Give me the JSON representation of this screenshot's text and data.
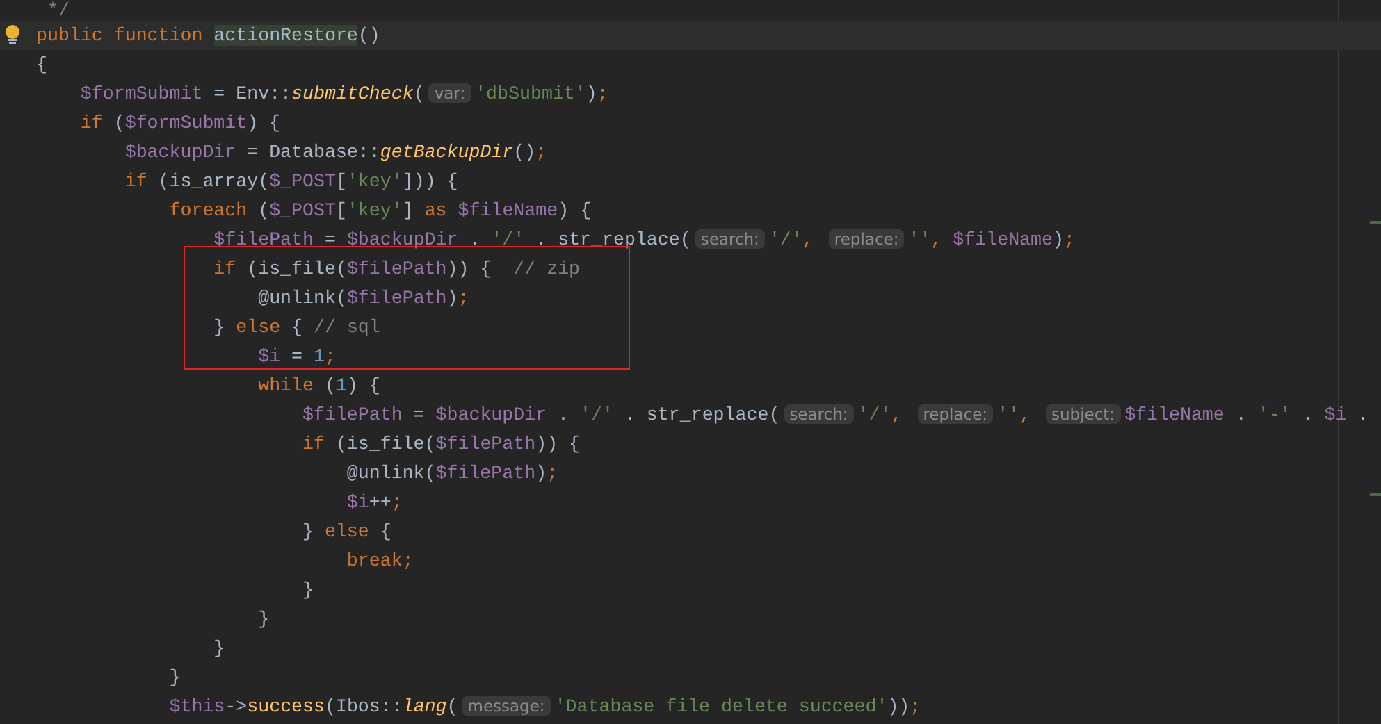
{
  "editor": {
    "lines": [
      {
        "current": false,
        "boxed": false,
        "tokens": [
          {
            "kind": "comment",
            "text": " */"
          }
        ]
      },
      {
        "current": true,
        "boxed": false,
        "tokens": [
          {
            "kind": "keyword",
            "text": "public function "
          },
          {
            "kind": "declaration",
            "text": "actionRestore"
          },
          {
            "kind": "plain",
            "text": "()"
          }
        ]
      },
      {
        "current": false,
        "boxed": false,
        "tokens": [
          {
            "kind": "plain",
            "text": "{"
          }
        ]
      },
      {
        "current": false,
        "boxed": false,
        "tokens": [
          {
            "kind": "variable",
            "text": "    $formSubmit"
          },
          {
            "kind": "plain",
            "text": " = Env::"
          },
          {
            "kind": "static",
            "text": "submitCheck"
          },
          {
            "kind": "plain",
            "text": "("
          },
          {
            "kind": "hint",
            "text": "var:"
          },
          {
            "kind": "string",
            "text": "'dbSubmit'"
          },
          {
            "kind": "plain",
            "text": ")"
          },
          {
            "kind": "keyword",
            "text": ";"
          }
        ]
      },
      {
        "current": false,
        "boxed": false,
        "tokens": [
          {
            "kind": "keyword",
            "text": "    if "
          },
          {
            "kind": "plain",
            "text": "("
          },
          {
            "kind": "variable",
            "text": "$formSubmit"
          },
          {
            "kind": "plain",
            "text": ") {"
          }
        ]
      },
      {
        "current": false,
        "boxed": false,
        "tokens": [
          {
            "kind": "variable",
            "text": "        $backupDir"
          },
          {
            "kind": "plain",
            "text": " = Database::"
          },
          {
            "kind": "static",
            "text": "getBackupDir"
          },
          {
            "kind": "plain",
            "text": "()"
          },
          {
            "kind": "keyword",
            "text": ";"
          }
        ]
      },
      {
        "current": false,
        "boxed": false,
        "tokens": [
          {
            "kind": "keyword",
            "text": "        if "
          },
          {
            "kind": "plain",
            "text": "(is_array("
          },
          {
            "kind": "variable",
            "text": "$_POST"
          },
          {
            "kind": "plain",
            "text": "["
          },
          {
            "kind": "string",
            "text": "'key'"
          },
          {
            "kind": "plain",
            "text": "])) {"
          }
        ]
      },
      {
        "current": false,
        "boxed": false,
        "tokens": [
          {
            "kind": "keyword",
            "text": "            foreach "
          },
          {
            "kind": "plain",
            "text": "("
          },
          {
            "kind": "variable",
            "text": "$_POST"
          },
          {
            "kind": "plain",
            "text": "["
          },
          {
            "kind": "string",
            "text": "'key'"
          },
          {
            "kind": "plain",
            "text": "] "
          },
          {
            "kind": "keyword",
            "text": "as "
          },
          {
            "kind": "variable",
            "text": "$fileName"
          },
          {
            "kind": "plain",
            "text": ") {"
          }
        ]
      },
      {
        "current": false,
        "boxed": false,
        "tokens": [
          {
            "kind": "variable",
            "text": "                $filePath"
          },
          {
            "kind": "plain",
            "text": " = "
          },
          {
            "kind": "variable",
            "text": "$backupDir"
          },
          {
            "kind": "plain",
            "text": " . "
          },
          {
            "kind": "string",
            "text": "'/'"
          },
          {
            "kind": "plain",
            "text": " . str_replace("
          },
          {
            "kind": "hint",
            "text": "search:"
          },
          {
            "kind": "string",
            "text": "'/'"
          },
          {
            "kind": "keyword",
            "text": ", "
          },
          {
            "kind": "hint",
            "text": "replace:"
          },
          {
            "kind": "string",
            "text": "''"
          },
          {
            "kind": "keyword",
            "text": ", "
          },
          {
            "kind": "variable",
            "text": "$fileName"
          },
          {
            "kind": "plain",
            "text": ")"
          },
          {
            "kind": "keyword",
            "text": ";"
          }
        ]
      },
      {
        "current": false,
        "boxed": true,
        "tokens": [
          {
            "kind": "keyword",
            "text": "                if "
          },
          {
            "kind": "plain",
            "text": "(is_file("
          },
          {
            "kind": "variable",
            "text": "$filePath"
          },
          {
            "kind": "plain",
            "text": ")) {  "
          },
          {
            "kind": "comment",
            "text": "// zip"
          }
        ]
      },
      {
        "current": false,
        "boxed": true,
        "tokens": [
          {
            "kind": "plain",
            "text": "                    @unlink("
          },
          {
            "kind": "variable",
            "text": "$filePath"
          },
          {
            "kind": "plain",
            "text": ")"
          },
          {
            "kind": "keyword",
            "text": ";"
          }
        ]
      },
      {
        "current": false,
        "boxed": true,
        "tokens": [
          {
            "kind": "plain",
            "text": "                } "
          },
          {
            "kind": "keyword",
            "text": "else "
          },
          {
            "kind": "plain",
            "text": "{ "
          },
          {
            "kind": "comment",
            "text": "// sql"
          }
        ]
      },
      {
        "current": false,
        "boxed": true,
        "tokens": [
          {
            "kind": "variable",
            "text": "                    $i"
          },
          {
            "kind": "plain",
            "text": " = "
          },
          {
            "kind": "number",
            "text": "1"
          },
          {
            "kind": "keyword",
            "text": ";"
          }
        ]
      },
      {
        "current": false,
        "boxed": false,
        "tokens": [
          {
            "kind": "keyword",
            "text": "                    while "
          },
          {
            "kind": "plain",
            "text": "("
          },
          {
            "kind": "number",
            "text": "1"
          },
          {
            "kind": "plain",
            "text": ") {"
          }
        ]
      },
      {
        "current": false,
        "boxed": false,
        "tokens": [
          {
            "kind": "variable",
            "text": "                        $filePath"
          },
          {
            "kind": "plain",
            "text": " = "
          },
          {
            "kind": "variable",
            "text": "$backupDir"
          },
          {
            "kind": "plain",
            "text": " . "
          },
          {
            "kind": "string",
            "text": "'/'"
          },
          {
            "kind": "plain",
            "text": " . str_replace("
          },
          {
            "kind": "hint",
            "text": "search:"
          },
          {
            "kind": "string",
            "text": "'/'"
          },
          {
            "kind": "keyword",
            "text": ", "
          },
          {
            "kind": "hint",
            "text": "replace:"
          },
          {
            "kind": "string",
            "text": "''"
          },
          {
            "kind": "keyword",
            "text": ", "
          },
          {
            "kind": "hint",
            "text": "subject:"
          },
          {
            "kind": "variable",
            "text": "$fileName"
          },
          {
            "kind": "plain",
            "text": " . "
          },
          {
            "kind": "string",
            "text": "'-'"
          },
          {
            "kind": "plain",
            "text": " . "
          },
          {
            "kind": "variable",
            "text": "$i"
          },
          {
            "kind": "plain",
            "text": " ."
          }
        ]
      },
      {
        "current": false,
        "boxed": false,
        "tokens": [
          {
            "kind": "keyword",
            "text": "                        if "
          },
          {
            "kind": "plain",
            "text": "(is_file("
          },
          {
            "kind": "variable",
            "text": "$filePath"
          },
          {
            "kind": "plain",
            "text": ")) {"
          }
        ]
      },
      {
        "current": false,
        "boxed": false,
        "tokens": [
          {
            "kind": "plain",
            "text": "                            @unlink("
          },
          {
            "kind": "variable",
            "text": "$filePath"
          },
          {
            "kind": "plain",
            "text": ")"
          },
          {
            "kind": "keyword",
            "text": ";"
          }
        ]
      },
      {
        "current": false,
        "boxed": false,
        "tokens": [
          {
            "kind": "variable",
            "text": "                            $i"
          },
          {
            "kind": "plain",
            "text": "++"
          },
          {
            "kind": "keyword",
            "text": ";"
          }
        ]
      },
      {
        "current": false,
        "boxed": false,
        "tokens": [
          {
            "kind": "plain",
            "text": "                        } "
          },
          {
            "kind": "keyword",
            "text": "else "
          },
          {
            "kind": "plain",
            "text": "{"
          }
        ]
      },
      {
        "current": false,
        "boxed": false,
        "tokens": [
          {
            "kind": "keyword",
            "text": "                            break;"
          }
        ]
      },
      {
        "current": false,
        "boxed": false,
        "tokens": [
          {
            "kind": "plain",
            "text": "                        }"
          }
        ]
      },
      {
        "current": false,
        "boxed": false,
        "tokens": [
          {
            "kind": "plain",
            "text": "                    }"
          }
        ]
      },
      {
        "current": false,
        "boxed": false,
        "tokens": [
          {
            "kind": "plain",
            "text": "                }"
          }
        ]
      },
      {
        "current": false,
        "boxed": false,
        "tokens": [
          {
            "kind": "plain",
            "text": "            }"
          }
        ]
      },
      {
        "current": false,
        "boxed": false,
        "tokens": [
          {
            "kind": "variable",
            "text": "            $this"
          },
          {
            "kind": "plain",
            "text": "->"
          },
          {
            "kind": "method",
            "text": "success"
          },
          {
            "kind": "plain",
            "text": "(Ibos::"
          },
          {
            "kind": "static",
            "text": "lang"
          },
          {
            "kind": "plain",
            "text": "("
          },
          {
            "kind": "hint",
            "text": "message:"
          },
          {
            "kind": "string",
            "text": "'Database file delete succeed'"
          },
          {
            "kind": "plain",
            "text": "))"
          },
          {
            "kind": "keyword",
            "text": ";"
          }
        ]
      }
    ]
  }
}
